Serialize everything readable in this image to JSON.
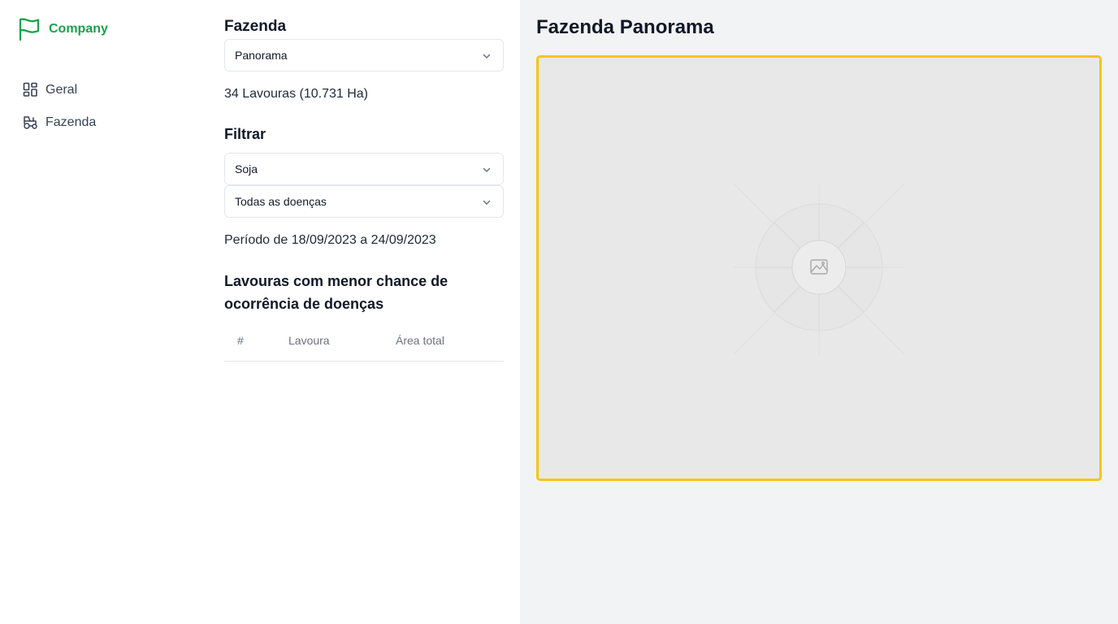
{
  "sidebar": {
    "brand": {
      "name": "Company",
      "icon": "flag-icon",
      "color": "#16a34a"
    },
    "items": [
      {
        "label": "Geral",
        "icon": "dashboard-icon"
      },
      {
        "label": "Fazenda",
        "icon": "tractor-icon"
      }
    ]
  },
  "panel": {
    "farm_label": "Fazenda",
    "farm_select": {
      "value": "Panorama"
    },
    "summary": "34 Lavouras (10.731 Ha)",
    "filter_label": "Filtrar",
    "crop_select": {
      "value": "Soja"
    },
    "disease_select": {
      "value": "Todas as doenças"
    },
    "period": "Período de 18/09/2023 a 24/09/2023",
    "ranking_title": "Lavouras com menor chance de ocorrência de doenças",
    "table": {
      "columns": [
        "#",
        "Lavoura",
        "Área total"
      ],
      "rows": []
    }
  },
  "map": {
    "title": "Fazenda Panorama",
    "placeholder_icon": "image-placeholder-icon",
    "border_color": "#f5c518"
  }
}
